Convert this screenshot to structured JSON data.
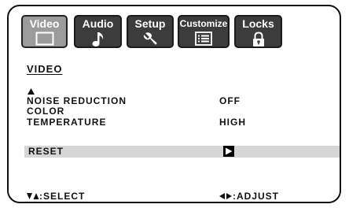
{
  "tabs": [
    {
      "label": "Video",
      "icon": "monitor-icon",
      "active": true
    },
    {
      "label": "Audio",
      "icon": "music-note-icon",
      "active": false
    },
    {
      "label": "Setup",
      "icon": "wrench-icon",
      "active": false
    },
    {
      "label": "Customize",
      "icon": "list-icon",
      "active": false
    },
    {
      "label": "Locks",
      "icon": "padlock-icon",
      "active": false
    }
  ],
  "section_title": "VIDEO",
  "settings": {
    "noise_reduction": {
      "label": "NOISE REDUCTION",
      "value": "OFF"
    },
    "color_temperature": {
      "label_line1": "COLOR",
      "label_line2": "TEMPERATURE",
      "value": "HIGH"
    },
    "reset": {
      "label": "RESET"
    }
  },
  "hints": {
    "select": ":SELECT",
    "adjust": ":ADJUST"
  },
  "colors": {
    "tab_bg": "#3c3c3c",
    "tab_active_bg": "#9b9b9b",
    "highlight_bar": "#d6d6d6"
  }
}
